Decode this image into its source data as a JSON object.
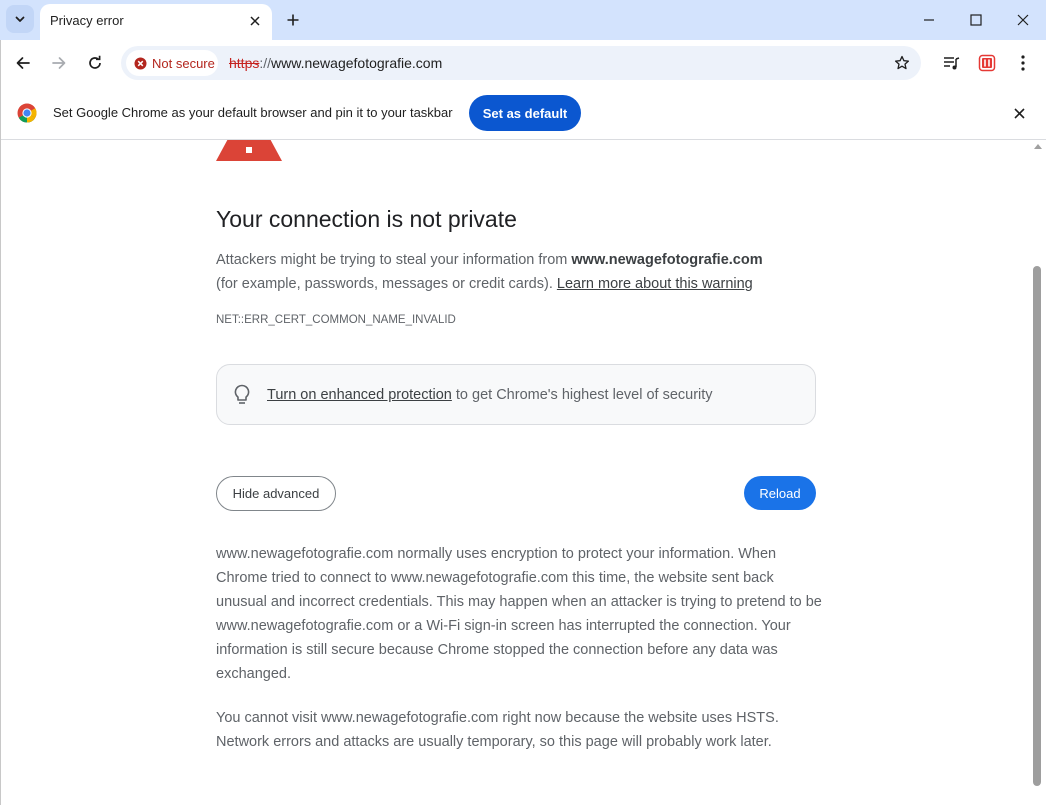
{
  "browser": {
    "tab": {
      "title": "Privacy error"
    },
    "address_bar": {
      "security_chip": "Not secure",
      "url_protocol": "https",
      "url_separator": "://",
      "url_host": "www.newagefotografie.com"
    },
    "infobar": {
      "message": "Set Google Chrome as your default browser and pin it to your taskbar",
      "button_label": "Set as default"
    }
  },
  "page": {
    "heading": "Your connection is not private",
    "intro": {
      "text_before": "Attackers might be trying to steal your information from ",
      "host_bold": "www.newagefotografie.com",
      "text_after": "(for example, passwords, messages or credit cards). ",
      "learn_more_link": "Learn more about this warning"
    },
    "error_code": "NET::ERR_CERT_COMMON_NAME_INVALID",
    "enhanced_protection": {
      "link_text": "Turn on enhanced protection",
      "rest_text": " to get Chrome's highest level of security"
    },
    "buttons": {
      "hide_advanced": "Hide advanced",
      "reload": "Reload"
    },
    "details": [
      "www.newagefotografie.com normally uses encryption to protect your information. When Chrome tried to connect to www.newagefotografie.com this time, the website sent back unusual and incorrect credentials. This may happen when an attacker is trying to pretend to be www.newagefotografie.com or a Wi-Fi sign-in screen has interrupted the connection. Your information is still secure because Chrome stopped the connection before any data was exchanged.",
      "You cannot visit www.newagefotografie.com right now because the website uses HSTS. Network errors and attacks are usually temporary, so this page will probably work later."
    ]
  },
  "colors": {
    "tabstrip_bg": "#d3e3fd",
    "warning_red": "#db4437",
    "not_secure_red": "#b3261e",
    "primary_blue": "#1a73e8",
    "infobar_button_blue": "#0b57d0"
  },
  "icons": [
    "tab-search-icon",
    "close-icon",
    "plus-icon",
    "minimize-icon",
    "maximize-icon",
    "back-arrow-icon",
    "forward-arrow-icon",
    "reload-icon",
    "error-circle-icon",
    "star-icon",
    "media-control-icon",
    "extension-icon",
    "kebab-menu-icon",
    "chrome-logo-icon",
    "warning-triangle-icon",
    "lightbulb-icon"
  ]
}
